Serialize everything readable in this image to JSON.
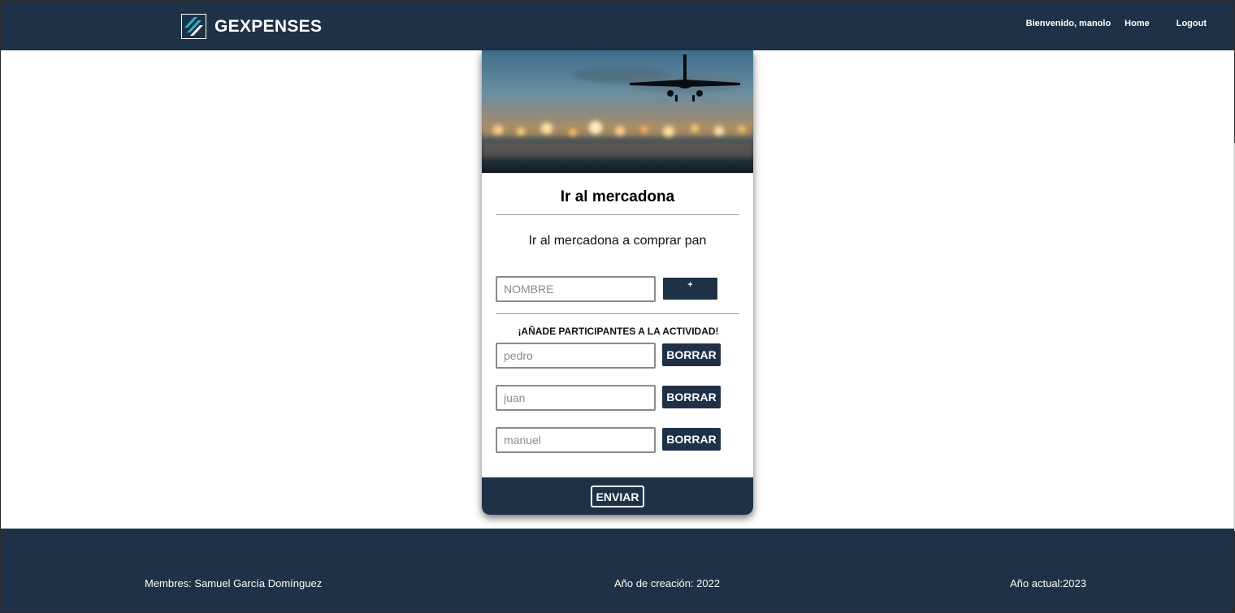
{
  "navbar": {
    "brand_name": "GEXPENSES",
    "logo_icon": "gexpenses-logo-icon",
    "welcome_text": "Bienvenido, manolo",
    "home_label": "Home",
    "logout_label": "Logout"
  },
  "card": {
    "image_icon": "airplane-photo",
    "title": "Ir al mercadona",
    "description": "Ir al mercadona a comprar pan",
    "name_input": {
      "placeholder": "NOMBRE",
      "value": ""
    },
    "add_button_label": "+",
    "participants_heading": "¡AÑADE PARTICIPANTES A LA ACTIVIDAD!",
    "participants": [
      {
        "placeholder": "pedro",
        "delete_label": "BORRAR"
      },
      {
        "placeholder": "juan",
        "delete_label": "BORRAR"
      },
      {
        "placeholder": "manuel",
        "delete_label": "BORRAR"
      }
    ],
    "send_label": "ENVIAR"
  },
  "footer": {
    "members": "Membres: Samuel García Domínguez",
    "created": "Año de creación: 2022",
    "current": "Año actual:2023"
  },
  "colors": {
    "navy": "#1e3147",
    "white": "#ffffff"
  }
}
